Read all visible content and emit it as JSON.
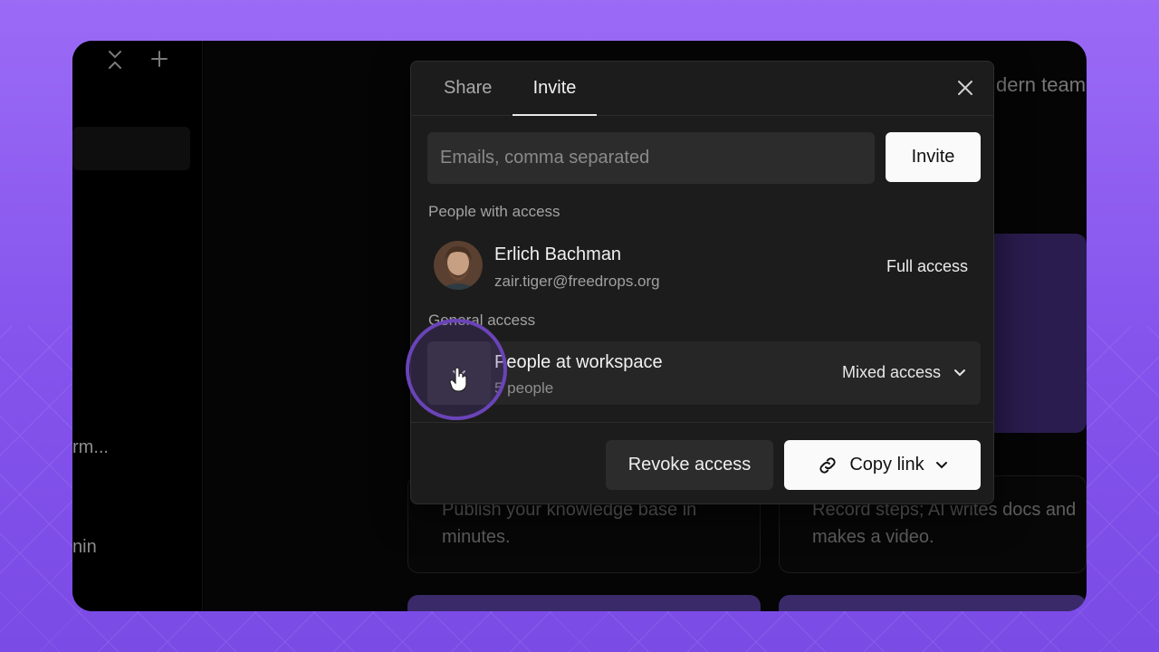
{
  "background": {
    "colors": {
      "accent": "#8a5cf0"
    }
  },
  "sidebar": {
    "collapse_icon": "collapse-icon",
    "add_icon": "plus-icon",
    "item_partial_1": "rm...",
    "item_partial_2": "nin"
  },
  "content": {
    "heading_partial": "dern team",
    "card_left_text": "Publish your knowledge base in minutes.",
    "card_right_text": "Record steps; AI writes docs and makes a video."
  },
  "modal": {
    "tabs": [
      {
        "label": "Share",
        "active": false
      },
      {
        "label": "Invite",
        "active": true
      }
    ],
    "close_icon": "close-icon",
    "invite": {
      "placeholder": "Emails, comma separated",
      "value": "",
      "button_label": "Invite"
    },
    "people_section_label": "People with access",
    "people": [
      {
        "name": "Erlich Bachman",
        "email": "zair.tiger@freedrops.org",
        "access": "Full access"
      }
    ],
    "general_section_label": "General access",
    "general": {
      "title": "People at workspace",
      "subtitle": "5 people",
      "access": "Mixed access",
      "icon": "expand-arrows-icon"
    },
    "footer": {
      "revoke_label": "Revoke access",
      "copy_label": "Copy link",
      "copy_icon": "link-icon"
    }
  },
  "cursor": {
    "icon": "pointer-hand-icon",
    "ring_color": "#6a44b8"
  }
}
